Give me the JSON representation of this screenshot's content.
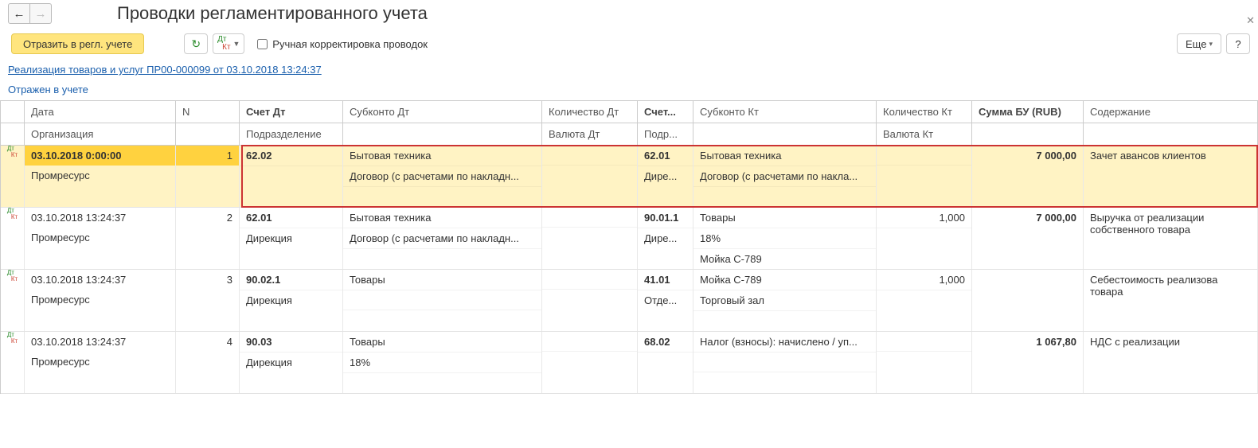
{
  "header": {
    "title": "Проводки регламентированного учета"
  },
  "toolbar": {
    "reflect_button": "Отразить в регл. учете",
    "manual_correction": "Ручная корректировка проводок",
    "more": "Еще",
    "help": "?"
  },
  "doc_link": "Реализация товаров и услуг ПР00-000099 от 03.10.2018 13:24:37",
  "status": "Отражен в учете",
  "columns": {
    "row1": {
      "date": "Дата",
      "n": "N",
      "acc_dt": "Счет Дт",
      "sub_dt": "Субконто Дт",
      "qty_dt": "Количество Дт",
      "acc_kt": "Счет...",
      "sub_kt": "Субконто Кт",
      "qty_kt": "Количество Кт",
      "sum": "Сумма БУ (RUB)",
      "descr": "Содержание"
    },
    "row2": {
      "org": "Организация",
      "dept": "Подразделение",
      "curr_dt": "Валюта Дт",
      "dept_kt": "Подр...",
      "curr_kt": "Валюта Кт"
    }
  },
  "entries": [
    {
      "highlighted": true,
      "date": "03.10.2018 0:00:00",
      "org": "Промресурс",
      "n": "1",
      "acc_dt": "62.02",
      "dept_dt": "",
      "sub_dt_1": "Бытовая техника",
      "sub_dt_2": "Договор (с расчетами по накладн...",
      "sub_dt_3": "",
      "qty_dt": "",
      "curr_dt": "",
      "acc_kt": "62.01",
      "dept_kt": "Дире...",
      "sub_kt_1": "Бытовая техника",
      "sub_kt_2": "Договор (с расчетами по накла...",
      "sub_kt_3": "",
      "qty_kt": "",
      "curr_kt": "",
      "sum": "7 000,00",
      "descr": "Зачет авансов клиентов"
    },
    {
      "date": "03.10.2018 13:24:37",
      "org": "Промресурс",
      "n": "2",
      "acc_dt": "62.01",
      "dept_dt": "Дирекция",
      "sub_dt_1": "Бытовая техника",
      "sub_dt_2": "Договор (с расчетами по накладн...",
      "sub_dt_3": "",
      "qty_dt": "",
      "curr_dt": "",
      "acc_kt": "90.01.1",
      "dept_kt": "Дире...",
      "sub_kt_1": "Товары",
      "sub_kt_2": "18%",
      "sub_kt_3": "Мойка С-789",
      "qty_kt": "1,000",
      "curr_kt": "",
      "sum": "7 000,00",
      "descr": "Выручка от реализации собственного товара"
    },
    {
      "date": "03.10.2018 13:24:37",
      "org": "Промресурс",
      "n": "3",
      "acc_dt": "90.02.1",
      "dept_dt": "Дирекция",
      "sub_dt_1": "Товары",
      "sub_dt_2": "",
      "sub_dt_3": "",
      "qty_dt": "",
      "curr_dt": "",
      "acc_kt": "41.01",
      "dept_kt": "Отде...",
      "sub_kt_1": "Мойка С-789",
      "sub_kt_2": "Торговый зал",
      "sub_kt_3": "",
      "qty_kt": "1,000",
      "curr_kt": "",
      "sum": "",
      "descr": "Себестоимость реализова товара"
    },
    {
      "date": "03.10.2018 13:24:37",
      "org": "Промресурс",
      "n": "4",
      "acc_dt": "90.03",
      "dept_dt": "Дирекция",
      "sub_dt_1": "Товары",
      "sub_dt_2": "18%",
      "sub_dt_3": "",
      "qty_dt": "",
      "curr_dt": "",
      "acc_kt": "68.02",
      "dept_kt": "",
      "sub_kt_1": "Налог (взносы): начислено / уп...",
      "sub_kt_2": "",
      "sub_kt_3": "",
      "qty_kt": "",
      "curr_kt": "",
      "sum": "1 067,80",
      "descr": "НДС с реализации"
    }
  ]
}
